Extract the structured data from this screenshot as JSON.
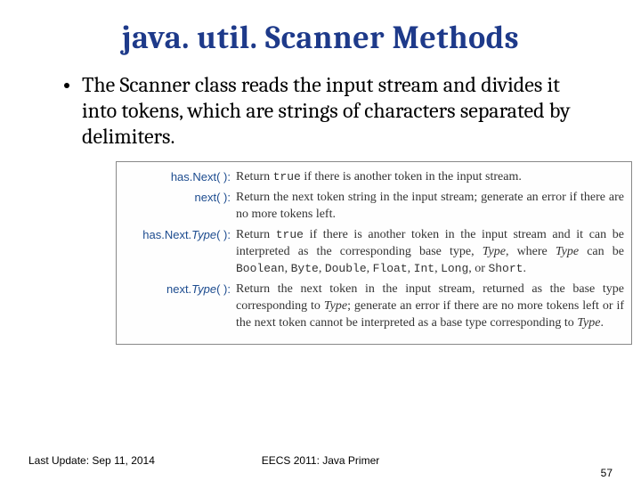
{
  "title": "java. util. Scanner Methods",
  "intro": "The Scanner class reads the input stream and divides it into tokens, which are strings of characters separated by delimiters.",
  "methods": [
    {
      "name_plain": "has.Next( ):",
      "name_italic": "",
      "desc_parts": [
        "Return ",
        {
          "mono": "true"
        },
        " if there is another token in the input stream."
      ]
    },
    {
      "name_plain": "next( ):",
      "name_italic": "",
      "desc_parts": [
        "Return the next token string in the input stream; generate an error if there are no more tokens left."
      ]
    },
    {
      "name_prefix": "has.Next.",
      "name_italic": "Type",
      "name_suffix": "( ):",
      "desc_parts": [
        "Return ",
        {
          "mono": "true"
        },
        " if there is another token in the input stream and it can be interpreted as the corresponding base type, ",
        {
          "ital": "Type"
        },
        ", where ",
        {
          "ital": "Type"
        },
        " can be ",
        {
          "mono": "Boolean"
        },
        ", ",
        {
          "mono": "Byte"
        },
        ", ",
        {
          "mono": "Double"
        },
        ", ",
        {
          "mono": "Float"
        },
        ", ",
        {
          "mono": "Int"
        },
        ", ",
        {
          "mono": "Long"
        },
        ", or ",
        {
          "mono": "Short"
        },
        "."
      ]
    },
    {
      "name_prefix": "next.",
      "name_italic": "Type",
      "name_suffix": "( ):",
      "desc_parts": [
        "Return the next token in the input stream, returned as the base type corresponding to ",
        {
          "ital": "Type"
        },
        "; generate an error if there are no more tokens left or if the next token cannot be interpreted as a base type corresponding to ",
        {
          "ital": "Type"
        },
        "."
      ]
    }
  ],
  "footer": {
    "left": "Last Update: Sep 11, 2014",
    "center": "EECS 2011: Java Primer",
    "right": "57"
  }
}
